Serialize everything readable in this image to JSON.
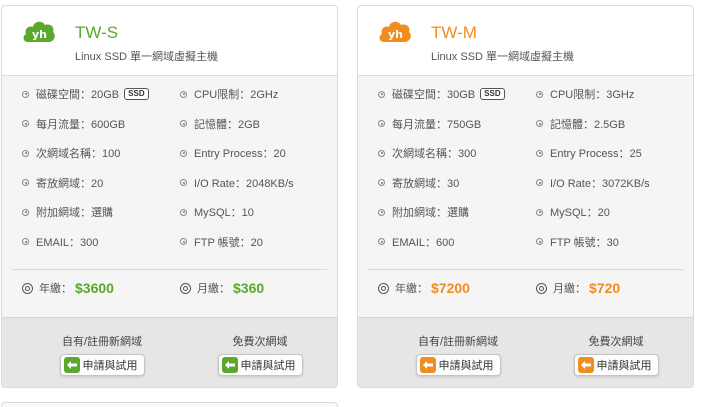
{
  "colors": {
    "green": "#5aa82c",
    "orange": "#f18d1e"
  },
  "plans": [
    {
      "name": "TW-S",
      "subtitle": "Linux SSD 單一網域虛擬主機",
      "logo_icon": "cloud-logo-icon",
      "specs": [
        [
          "磁碟空間：20GB",
          "CPU限制：2GHz"
        ],
        [
          "每月流量：600GB",
          "記憶體：2GB"
        ],
        [
          "次網域名稱：100",
          "Entry Process：20"
        ],
        [
          "寄放網域：20",
          "I/O Rate：2048KB/s"
        ],
        [
          "附加網域：選購",
          "MySQL：10"
        ],
        [
          "EMAIL：300",
          "FTP 帳號：20"
        ]
      ],
      "ssd_badge": "SSD",
      "price_year_label": "年繳：",
      "price_year": "$3600",
      "price_month_label": "月繳：",
      "price_month": "$360",
      "action_left_label": "自有/註冊新網域",
      "action_right_label": "免費次網域",
      "apply_label": "申請與試用"
    },
    {
      "name": "TW-M",
      "subtitle": "Linux SSD 單一網域虛擬主機",
      "logo_icon": "cloud-logo-icon",
      "specs": [
        [
          "磁碟空間：30GB",
          "CPU限制：3GHz"
        ],
        [
          "每月流量：750GB",
          "記憶體：2.5GB"
        ],
        [
          "次網域名稱：300",
          "Entry Process：25"
        ],
        [
          "寄放網域：30",
          "I/O Rate：3072KB/s"
        ],
        [
          "附加網域：選購",
          "MySQL：20"
        ],
        [
          "EMAIL：600",
          "FTP 帳號：30"
        ]
      ],
      "ssd_badge": "SSD",
      "price_year_label": "年繳：",
      "price_year": "$7200",
      "price_month_label": "月繳：",
      "price_month": "$720",
      "action_left_label": "自有/註冊新網域",
      "action_right_label": "免費次網域",
      "apply_label": "申請與試用"
    }
  ]
}
